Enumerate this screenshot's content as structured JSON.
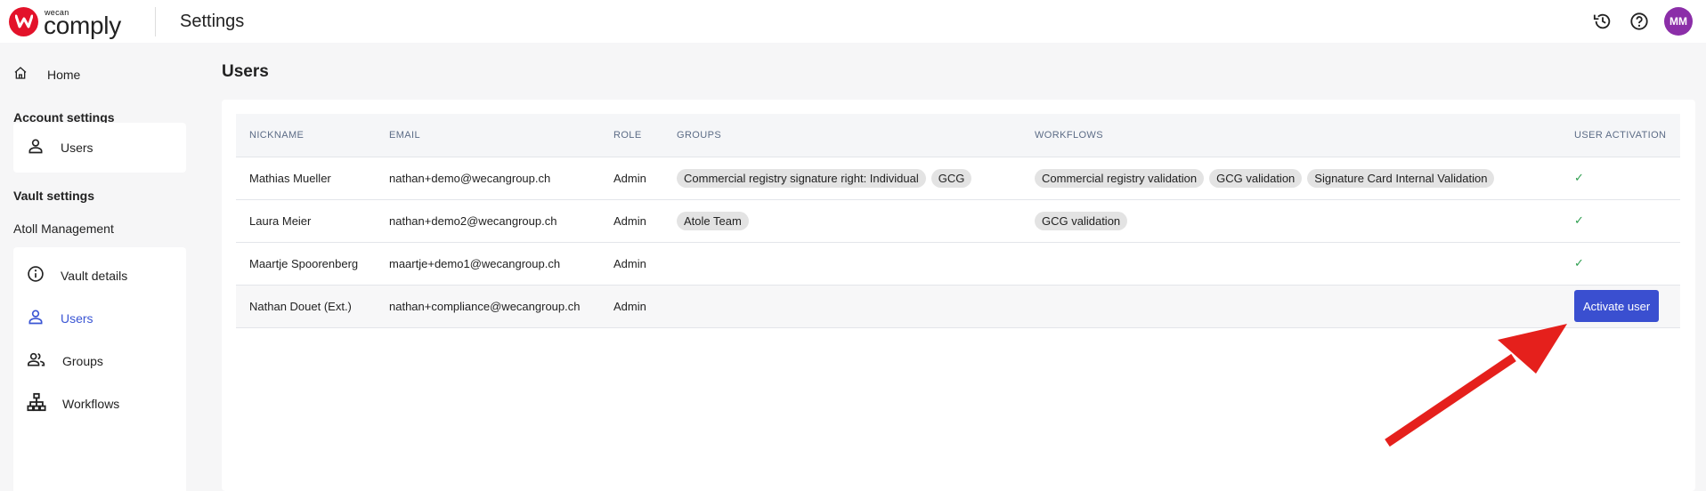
{
  "app": {
    "brand_small": "wecan",
    "brand_big": "comply",
    "page_title": "Settings",
    "avatar_initials": "MM"
  },
  "sidebar": {
    "home_label": "Home",
    "account_settings_heading": "Account settings",
    "account_items": [
      {
        "label": "Users",
        "icon": "person-icon"
      }
    ],
    "vault_settings_heading": "Vault settings",
    "vault_name": "Atoll Management",
    "vault_items": [
      {
        "label": "Vault details",
        "icon": "info-icon",
        "active": false
      },
      {
        "label": "Users",
        "icon": "person-icon",
        "active": true
      },
      {
        "label": "Groups",
        "icon": "group-icon",
        "active": false
      },
      {
        "label": "Workflows",
        "icon": "workflow-icon",
        "active": false
      }
    ]
  },
  "main": {
    "title": "Users",
    "columns": [
      "NICKNAME",
      "EMAIL",
      "ROLE",
      "GROUPS",
      "WORKFLOWS",
      "USER ACTIVATION"
    ],
    "rows": [
      {
        "nickname": "Mathias Mueller",
        "email": "nathan+demo@wecangroup.ch",
        "role": "Admin",
        "groups": [
          "Commercial registry signature right: Individual",
          "GCG"
        ],
        "workflows": [
          "Commercial registry validation",
          "GCG validation",
          "Signature Card Internal Validation"
        ],
        "activation": "✓"
      },
      {
        "nickname": "Laura Meier",
        "email": "nathan+demo2@wecangroup.ch",
        "role": "Admin",
        "groups": [
          "Atole Team"
        ],
        "workflows": [
          "GCG validation"
        ],
        "activation": "✓"
      },
      {
        "nickname": "Maartje Spoorenberg",
        "email": "maartje+demo1@wecangroup.ch",
        "role": "Admin",
        "groups": [],
        "workflows": [],
        "activation": "✓"
      },
      {
        "nickname": "Nathan Douet (Ext.)",
        "email": "nathan+compliance@wecangroup.ch",
        "role": "Admin",
        "groups": [],
        "workflows": [],
        "activation_button": "Activate user"
      }
    ]
  },
  "colors": {
    "brand": "#e3122a",
    "accent": "#3a55d4",
    "button": "#3a4fd0",
    "check": "#2e9e4f",
    "annotation_arrow": "#e5201c",
    "avatar": "#8b2ea8"
  }
}
